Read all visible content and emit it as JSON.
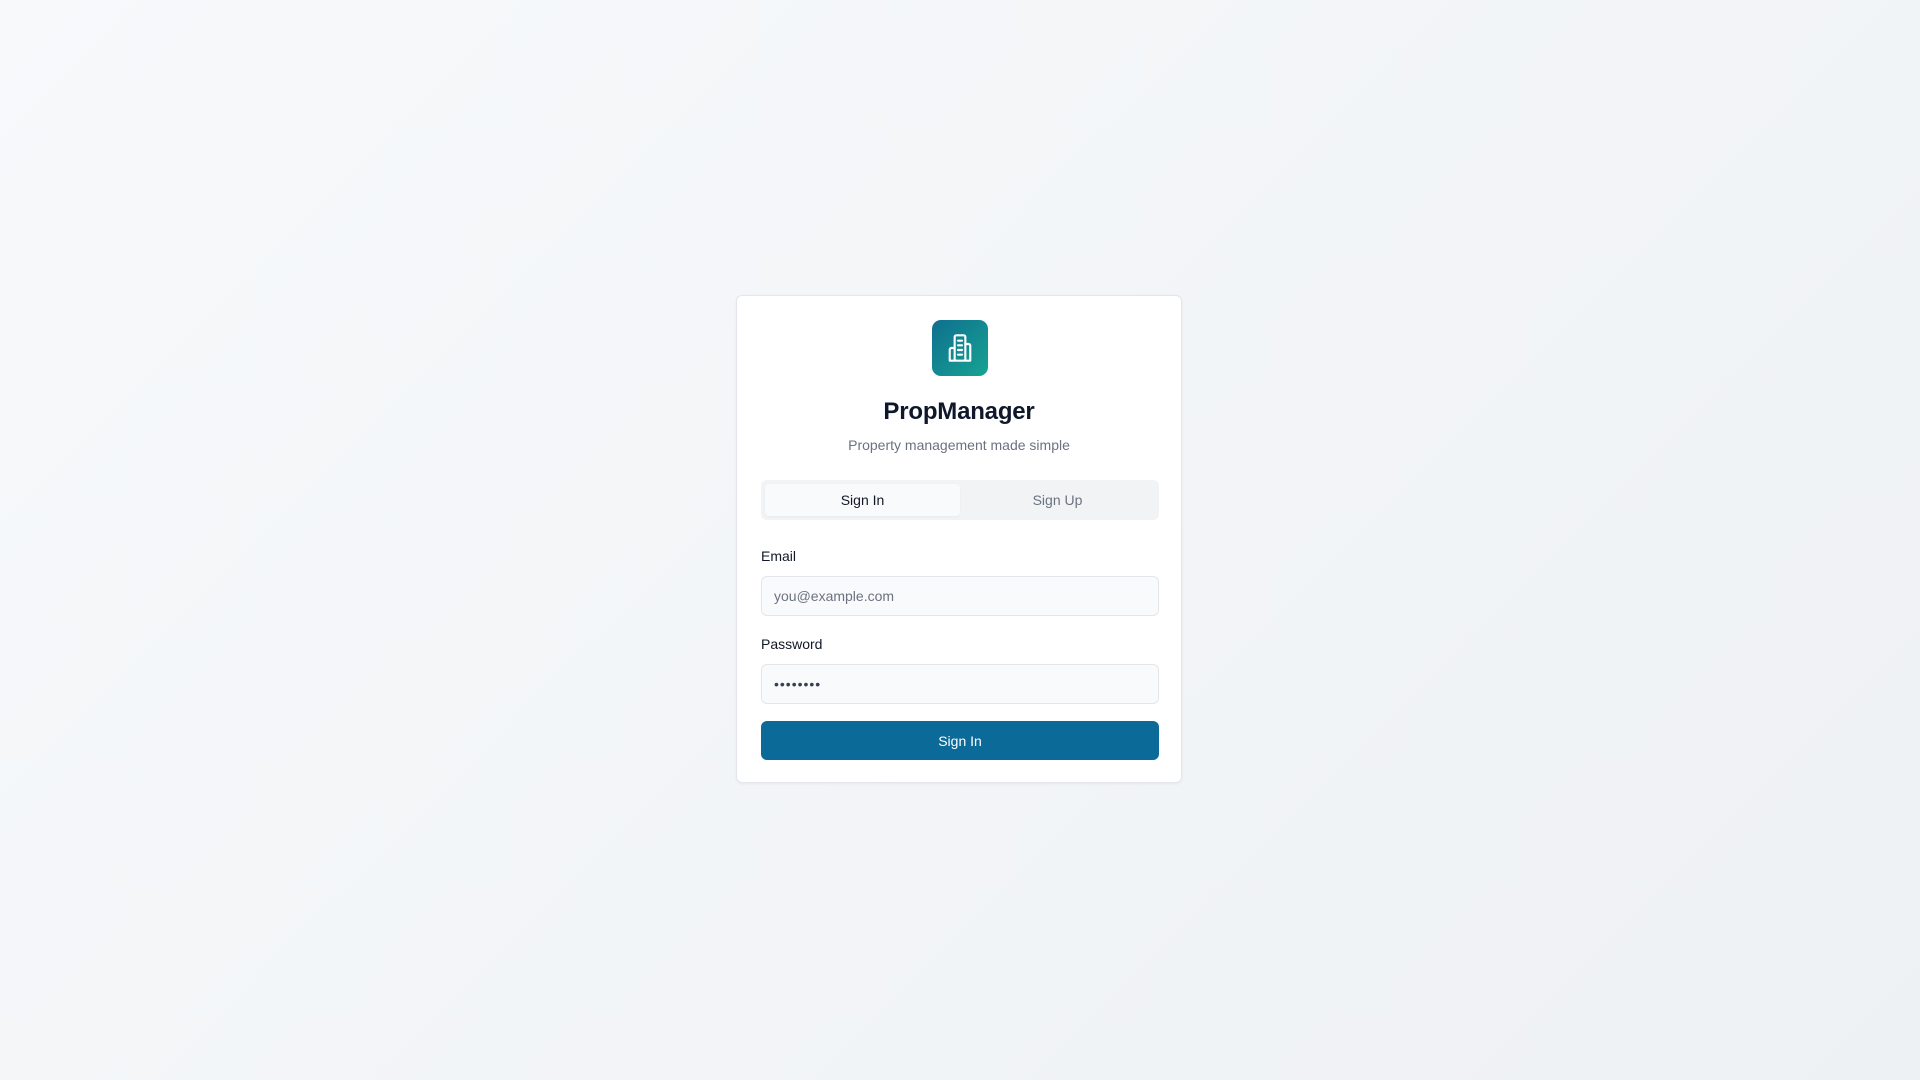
{
  "app": {
    "title": "PropManager",
    "tagline": "Property management made simple",
    "logo_icon": "building-icon",
    "brand_gradient": [
      "#0e6f8f",
      "#17a392"
    ]
  },
  "auth_tabs": [
    {
      "label": "Sign In",
      "active": true
    },
    {
      "label": "Sign Up",
      "active": false
    }
  ],
  "form": {
    "email": {
      "label": "Email",
      "placeholder": "you@example.com",
      "value": ""
    },
    "password": {
      "label": "Password",
      "value": "••••••••"
    },
    "submit_label": "Sign In"
  },
  "colors": {
    "primary_button": "#0b6a98",
    "background": "#f4f6f8"
  }
}
